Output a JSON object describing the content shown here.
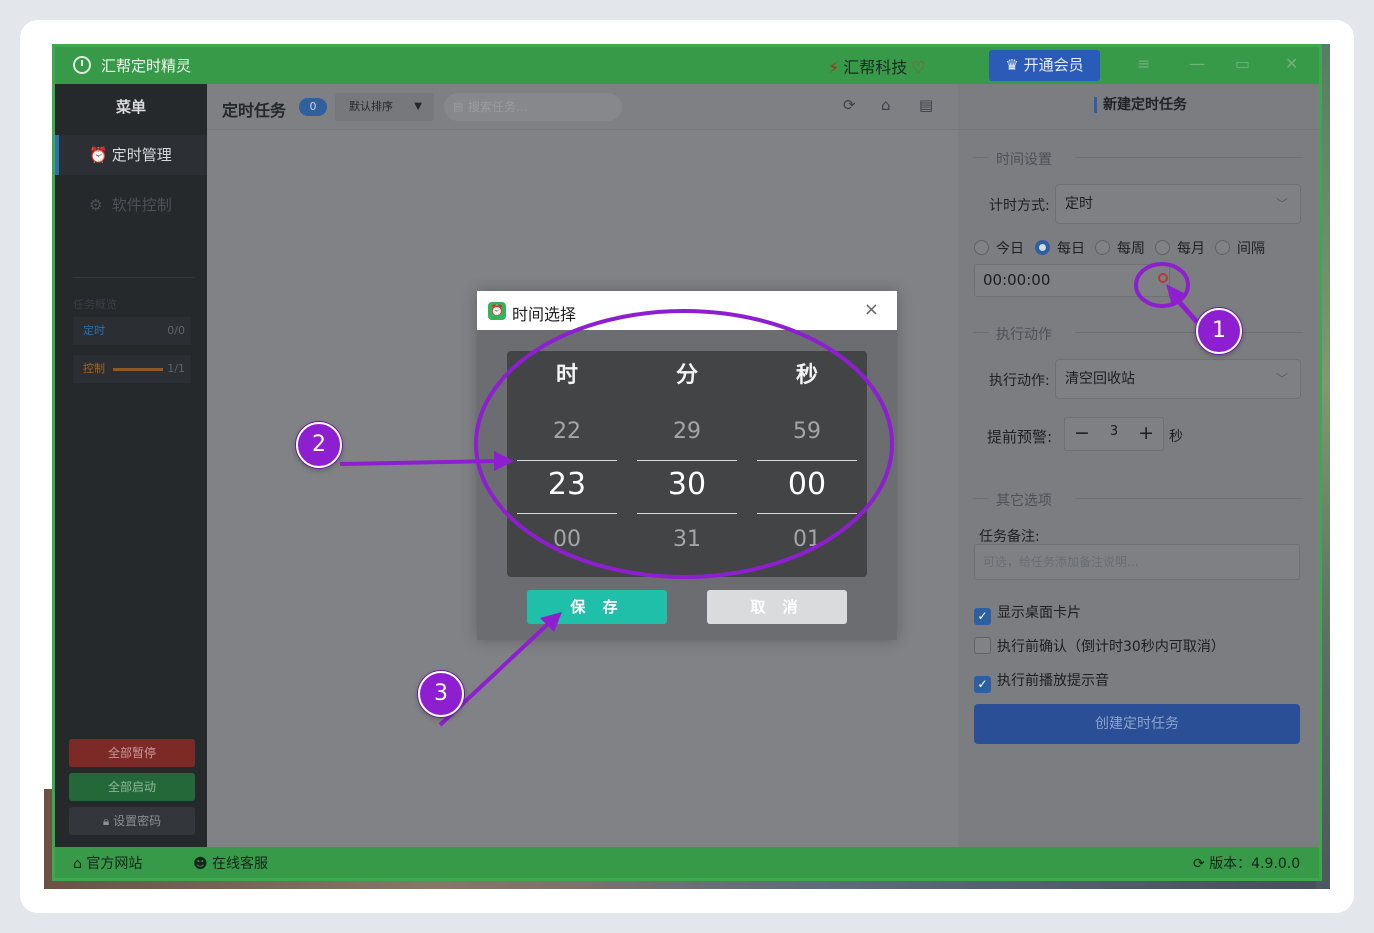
{
  "app": {
    "title": "汇帮定时精灵",
    "brand": "汇帮科技",
    "vip_label": "开通会员"
  },
  "sidebar": {
    "header": "菜单",
    "nav": [
      {
        "label": "定时管理",
        "icon": "alarm-clock-icon",
        "active": true
      },
      {
        "label": "软件控制",
        "icon": "gear-icon",
        "active": false
      }
    ],
    "overview_title": "任务概览",
    "stats": [
      {
        "label": "定时",
        "value": "0/0",
        "color": "#2a6fae"
      },
      {
        "label": "控制",
        "value": "1/1",
        "color": "#a0642b",
        "progress": 1.0
      }
    ],
    "buttons": {
      "pause_all": "全部暂停",
      "start_all": "全部启动",
      "set_password": "设置密码"
    }
  },
  "center": {
    "title": "定时任务",
    "count": "0",
    "sort_label": "默认排序",
    "search_placeholder": "搜索任务..."
  },
  "panel": {
    "title": "新建定时任务",
    "section_time": "时间设置",
    "timing_label": "计时方式:",
    "timing_value": "定时",
    "radios": [
      {
        "label": "今日",
        "checked": false
      },
      {
        "label": "每日",
        "checked": true
      },
      {
        "label": "每周",
        "checked": false
      },
      {
        "label": "每月",
        "checked": false
      },
      {
        "label": "间隔",
        "checked": false
      }
    ],
    "time_value": "00:00:00",
    "section_action": "执行动作",
    "action_label": "执行动作:",
    "action_value": "清空回收站",
    "warn_label": "提前预警:",
    "warn_value": "3",
    "warn_unit": "秒",
    "section_other": "其它选项",
    "note_label": "任务备注:",
    "note_placeholder": "可选，给任务添加备注说明...",
    "checks": [
      {
        "label": "显示桌面卡片",
        "checked": true
      },
      {
        "label": "执行前确认（倒计时30秒内可取消）",
        "checked": false
      },
      {
        "label": "执行前播放提示音",
        "checked": true
      }
    ],
    "create_label": "创建定时任务"
  },
  "footer": {
    "website": "官方网站",
    "support": "在线客服",
    "version": "版本：4.9.0.0"
  },
  "dialog": {
    "title": "时间选择",
    "headers": [
      "时",
      "分",
      "秒"
    ],
    "above": [
      "22",
      "29",
      "59"
    ],
    "selected": [
      "23",
      "30",
      "00"
    ],
    "below": [
      "00",
      "31",
      "01"
    ],
    "save_label": "保 存",
    "cancel_label": "取 消"
  },
  "annotations": {
    "color": "#8e1fd0",
    "badges": [
      "1",
      "2",
      "3"
    ]
  }
}
